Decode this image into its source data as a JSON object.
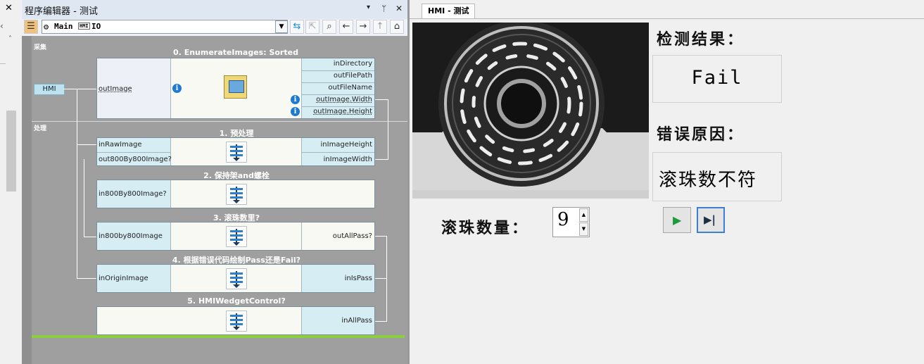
{
  "editor": {
    "title": "程序编辑器 - 测试",
    "close": "✕",
    "pin": "⊥",
    "menu": "▾",
    "toolbar": {
      "segments": [
        "Main",
        "IO"
      ]
    },
    "sections": {
      "acquire": "采集",
      "process": "处理"
    },
    "hmi_tag": "HMI",
    "nodes": [
      {
        "title": "0. EnumerateImages: Sorted",
        "inputs": [
          "outImage"
        ],
        "outputs": [
          "inDirectory",
          "outFilePath",
          "outFileName",
          "outImage.Width",
          "outImage.Height"
        ]
      },
      {
        "title": "1. 预处理",
        "inputs": [
          "inRawImage",
          "out800By800Image?"
        ],
        "outputs": [
          "inImageHeight",
          "inImageWidth"
        ]
      },
      {
        "title": "2. 保持架and螺栓",
        "inputs": [
          "in800By800Image?"
        ],
        "outputs": []
      },
      {
        "title": "3. 滚珠数里?",
        "inputs": [
          "in800by800Image"
        ],
        "outputs": [
          "outAllPass?"
        ]
      },
      {
        "title": "4. 根据错误代码绘制Pass还是Fail?",
        "inputs": [
          "inOriginImage"
        ],
        "outputs": [
          "inIsPass"
        ]
      },
      {
        "title": "5. HMIWedgetControl?",
        "inputs": [],
        "outputs": [
          "inAllPass"
        ]
      }
    ]
  },
  "hmi": {
    "tab": "HMI - 测试",
    "result_label": "检测结果：",
    "result_value": "Fail",
    "reason_label": "错误原因：",
    "reason_value": "滚珠数不符",
    "count_label": "滚珠数量：",
    "count_value": "9",
    "play_icon": "▶",
    "step_icon": "▶|"
  }
}
